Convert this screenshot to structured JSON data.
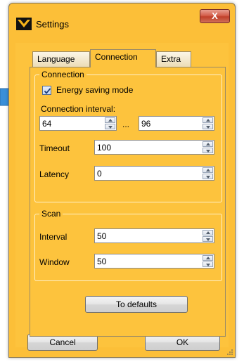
{
  "window": {
    "title": "Settings",
    "close_label": "X"
  },
  "tabs": [
    {
      "label": "Language",
      "active": false
    },
    {
      "label": "Connection",
      "active": true
    },
    {
      "label": "Extra",
      "active": false
    }
  ],
  "connection": {
    "group_label": "Connection",
    "energy_saving": {
      "label": "Energy saving mode",
      "checked": true
    },
    "interval_label": "Connection interval:",
    "interval_min": "64",
    "interval_sep": "...",
    "interval_max": "96",
    "timeout_label": "Timeout",
    "timeout_value": "100",
    "latency_label": "Latency",
    "latency_value": "0"
  },
  "scan": {
    "group_label": "Scan",
    "interval_label": "Interval",
    "interval_value": "50",
    "window_label": "Window",
    "window_value": "50"
  },
  "buttons": {
    "defaults": "To defaults",
    "cancel": "Cancel",
    "ok": "OK"
  },
  "colors": {
    "window_bg": "#fdc33d",
    "arrow": "#3a8fd8"
  },
  "icons": {
    "app": "app-logo-icon",
    "close": "close-icon",
    "pointer": "pointer-arrow-icon"
  }
}
